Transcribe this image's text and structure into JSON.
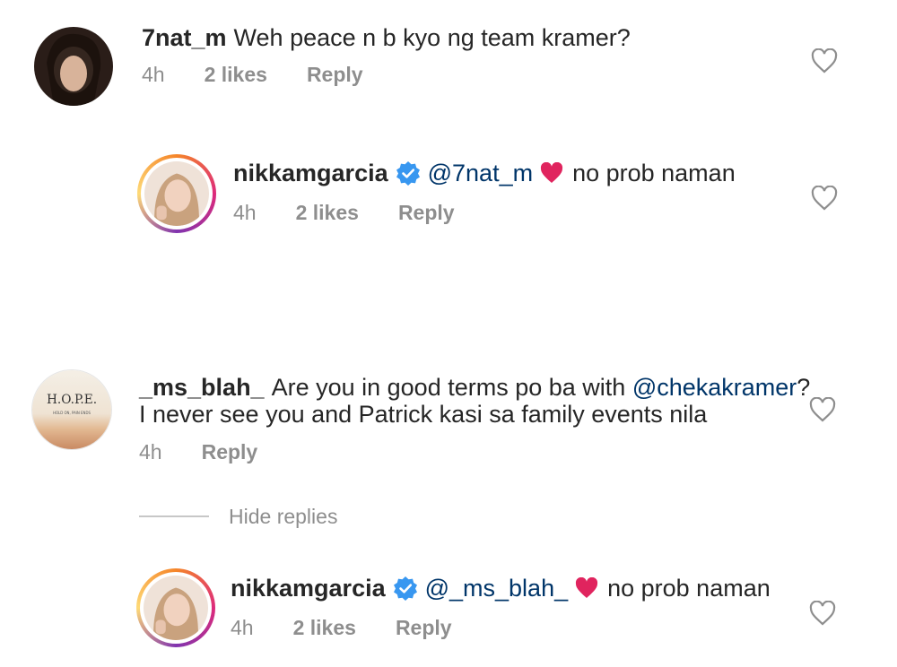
{
  "comments": [
    {
      "username": "7nat_m",
      "text": "Weh peace n b kyo ng team kramer?",
      "time": "4h",
      "likes": "2 likes",
      "reply": "Reply"
    },
    {
      "username": "nikkamgarcia",
      "mention": "@7nat_m",
      "text": "no prob naman",
      "time": "4h",
      "likes": "2 likes",
      "reply": "Reply"
    },
    {
      "username": "_ms_blah_",
      "text_line1_before": "Are you in good terms po ba with",
      "mention": "@chekakramer",
      "text_line1_after": "?",
      "text_line2": "I never see you and Patrick kasi sa family events nila",
      "time": "4h",
      "reply": "Reply",
      "avatar_text": "H.O.P.E.",
      "avatar_subtext": "HOLD ON, PAIN ENDS"
    },
    {
      "username": "nikkamgarcia",
      "mention": "@_ms_blah_",
      "text": "no prob naman",
      "time": "4h",
      "likes": "2 likes",
      "reply": "Reply"
    }
  ],
  "hide_replies": "Hide replies",
  "icons": [
    "heart-outline-icon",
    "verified-badge-icon",
    "red-heart-emoji"
  ],
  "colors": {
    "verified": "#3897f0",
    "mention": "#003569",
    "meta": "#8e8e8e",
    "red_heart": "#e0245e"
  }
}
